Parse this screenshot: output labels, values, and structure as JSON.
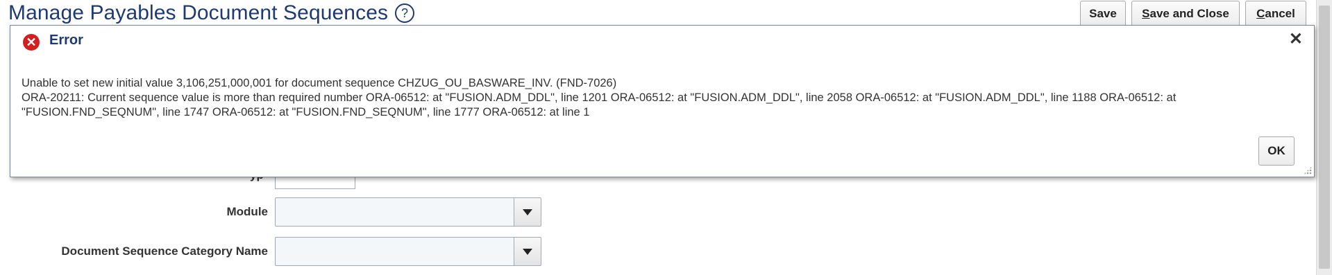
{
  "header": {
    "title": "Manage Payables Document Sequences",
    "help_symbol": "?"
  },
  "toolbar": {
    "save_label": "Save",
    "save_close_label": "Save and Close",
    "save_close_accel": "S",
    "save_close_rest": "ave and Close",
    "cancel_accel": "C",
    "cancel_rest": "ancel"
  },
  "form": {
    "partial_label_fragment": "yp",
    "module_label": "Module",
    "module_value": "",
    "category_label": "Document Sequence Category Name",
    "category_value": ""
  },
  "dialog": {
    "title": "Error",
    "close_symbol": "✕",
    "message_line1": "Unable to set new initial value 3,106,251,000,001 for document sequence CHZUG_OU_BASWARE_INV. (FND-7026)",
    "message_line2": "ORA-20211: Current sequence value is more than required number ORA-06512: at \"FUSION.ADM_DDL\", line 1201 ORA-06512: at \"FUSION.ADM_DDL\", line 2058 ORA-06512: at \"FUSION.ADM_DDL\", line 1188 ORA-06512: at \"FUSION.FND_SEQNUM\", line 1747 ORA-06512: at \"FUSION.FND_SEQNUM\", line 1777 ORA-06512: at line 1",
    "ok_label": "OK"
  },
  "colors": {
    "title_blue": "#1f3a73",
    "error_red": "#d21f1f"
  }
}
